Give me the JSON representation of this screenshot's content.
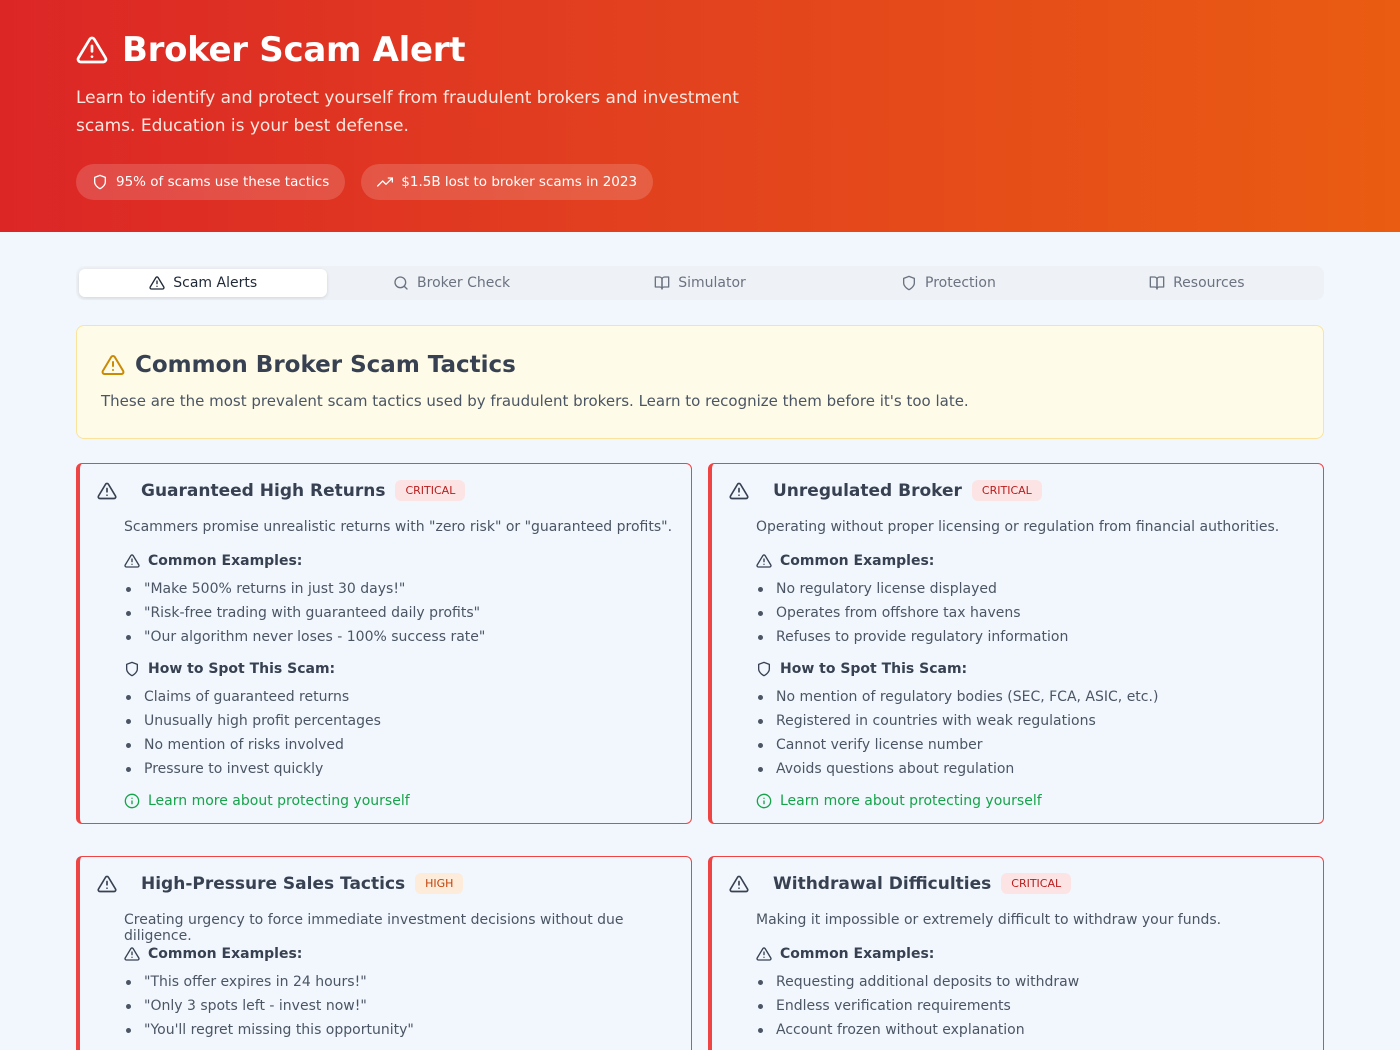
{
  "hero": {
    "title": "Broker Scam Alert",
    "subtitle": "Learn to identify and protect yourself from fraudulent brokers and investment scams. Education is your best defense.",
    "pills": [
      "95% of scams use these tactics",
      "$1.5B lost to broker scams in 2023"
    ]
  },
  "tabs": [
    "Scam Alerts",
    "Broker Check",
    "Simulator",
    "Protection",
    "Resources"
  ],
  "active_tab": "Scam Alerts",
  "intro": {
    "title": "Common Broker Scam Tactics",
    "description": "These are the most prevalent scam tactics used by fraudulent brokers. Learn to recognize them before it's too late."
  },
  "colors": {
    "hero_start": "#dc2626",
    "hero_end": "#ea5c12",
    "critical": "#ef4444",
    "learn": "#16a34a"
  },
  "cards": [
    {
      "glyph": "",
      "title": "Guaranteed High Returns",
      "badge": "CRITICAL",
      "description": "Scammers promise unrealistic returns with \"zero risk\" or \"guaranteed profits\".",
      "examples_label": "Common Examples:",
      "examples": [
        "\"Make 500% returns in just 30 days!\"",
        "\"Risk-free trading with guaranteed daily profits\"",
        "\"Our algorithm never loses - 100% success rate\""
      ],
      "spot_label": "How to Spot This Scam:",
      "spot": [
        "Claims of guaranteed returns",
        "Unusually high profit percentages",
        "No mention of risks involved",
        "Pressure to invest quickly"
      ],
      "learn_more": "Learn more about protecting yourself"
    },
    {
      "glyph": "",
      "title": "Unregulated Broker",
      "badge": "CRITICAL",
      "description": "Operating without proper licensing or regulation from financial authorities.",
      "examples_label": "Common Examples:",
      "examples": [
        "No regulatory license displayed",
        "Operates from offshore tax havens",
        "Refuses to provide regulatory information"
      ],
      "spot_label": "How to Spot This Scam:",
      "spot": [
        "No mention of regulatory bodies (SEC, FCA, ASIC, etc.)",
        "Registered in countries with weak regulations",
        "Cannot verify license number",
        "Avoids questions about regulation"
      ],
      "learn_more": "Learn more about protecting yourself"
    },
    {
      "glyph": "",
      "title": "High-Pressure Sales Tactics",
      "badge": "HIGH",
      "description": "Creating urgency to force immediate investment decisions without due diligence.",
      "examples_label": "Common Examples:",
      "examples": [
        "\"This offer expires in 24 hours!\"",
        "\"Only 3 spots left - invest now!\"",
        "\"You'll regret missing this opportunity\""
      ]
    },
    {
      "glyph": "",
      "title": "Withdrawal Difficulties",
      "badge": "CRITICAL",
      "description": "Making it impossible or extremely difficult to withdraw your funds.",
      "examples_label": "Common Examples:",
      "examples": [
        "Requesting additional deposits to withdraw",
        "Endless verification requirements",
        "Account frozen without explanation"
      ]
    }
  ]
}
